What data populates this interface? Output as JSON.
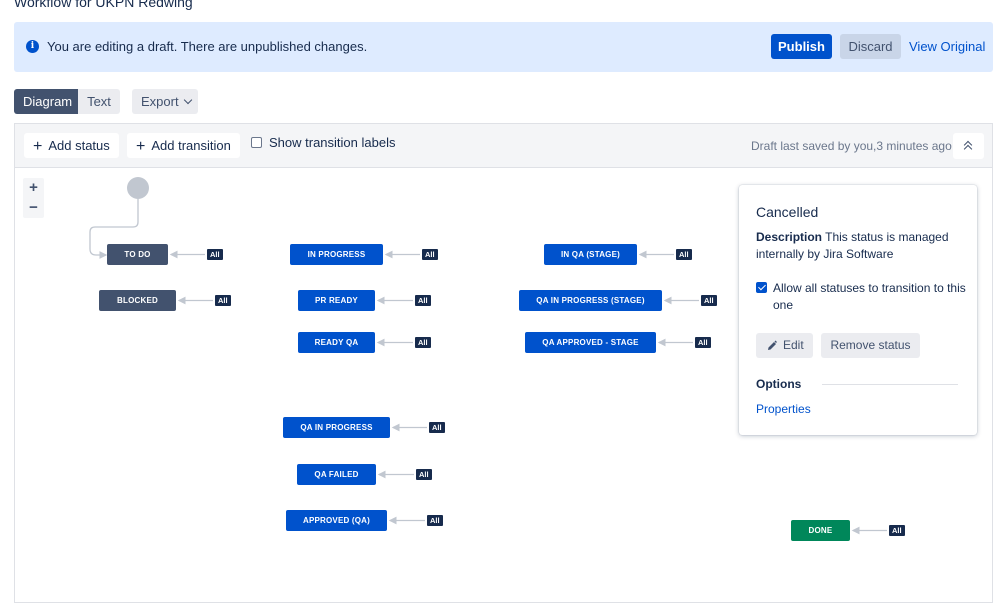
{
  "page": {
    "title": "Workflow for UKPN Redwing"
  },
  "banner": {
    "message": "You are editing a draft. There are unpublished changes.",
    "publish": "Publish",
    "discard": "Discard",
    "view_original": "View Original",
    "icon": "info-icon"
  },
  "view": {
    "diagram": "Diagram",
    "text": "Text",
    "export": "Export"
  },
  "toolbar": {
    "add_status": "Add status",
    "add_transition": "Add transition",
    "show_labels": "Show transition labels",
    "show_labels_checked": false,
    "saved": "Draft last saved by you,3 minutes ago"
  },
  "zoom": {
    "in": "+",
    "out": "−"
  },
  "statuses": [
    {
      "label": "TO DO",
      "color": "gray"
    },
    {
      "label": "BLOCKED",
      "color": "gray"
    },
    {
      "label": "IN PROGRESS",
      "color": "blue"
    },
    {
      "label": "PR READY",
      "color": "blue"
    },
    {
      "label": "READY QA",
      "color": "blue"
    },
    {
      "label": "IN QA (STAGE)",
      "color": "blue"
    },
    {
      "label": "QA IN PROGRESS (STAGE)",
      "color": "blue"
    },
    {
      "label": "QA APPROVED - STAGE",
      "color": "blue"
    },
    {
      "label": "QA IN PROGRESS",
      "color": "blue"
    },
    {
      "label": "QA FAILED",
      "color": "blue"
    },
    {
      "label": "APPROVED (QA)",
      "color": "blue"
    },
    {
      "label": "DONE",
      "color": "green"
    }
  ],
  "all_tag": "All",
  "panel": {
    "title": "Cancelled",
    "description_label": "Description",
    "description_text": "This status is managed internally by Jira Software",
    "allow_all": "Allow all statuses to transition to this one",
    "allow_all_checked": true,
    "edit": "Edit",
    "remove": "Remove status",
    "options": "Options",
    "properties": "Properties"
  },
  "colors": {
    "primary": "#0052cc",
    "gray_status": "#42526e",
    "green_status": "#00875a",
    "banner_bg": "#deebff"
  }
}
